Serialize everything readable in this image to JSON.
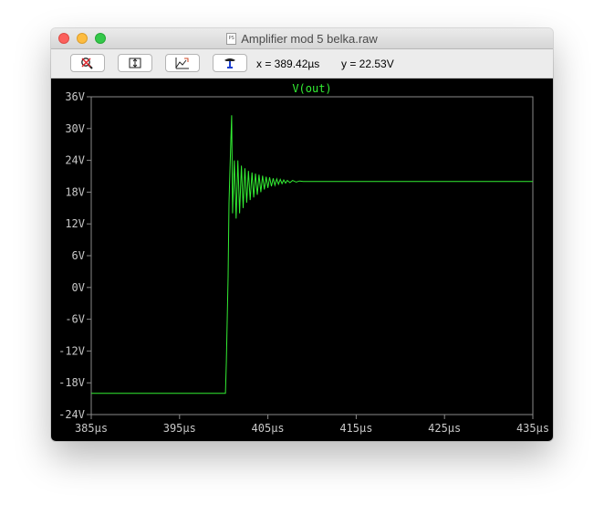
{
  "window": {
    "title": "Amplifier mod 5 belka.raw",
    "file_icon_label": "PS"
  },
  "toolbar": {
    "buttons": [
      {
        "name": "autorange-button",
        "icon": "zoom-reset-icon"
      },
      {
        "name": "zoom-extents-button",
        "icon": "zoom-extents-icon"
      },
      {
        "name": "zoom-back-button",
        "icon": "zoom-back-icon"
      },
      {
        "name": "probe-button",
        "icon": "probe-icon"
      }
    ],
    "cursor_x": "x = 389.42µs",
    "cursor_y": "y = 22.53V"
  },
  "colors": {
    "trace": "#33ee33",
    "axis": "#8a8a8a",
    "label": "#c8c8c8",
    "background": "#000000"
  },
  "chart_data": {
    "type": "line",
    "title": "V(out)",
    "xlabel": "",
    "ylabel": "",
    "xlim": [
      385,
      435
    ],
    "ylim": [
      -24,
      36
    ],
    "grid": false,
    "x_ticks": [
      385,
      395,
      405,
      415,
      425,
      435
    ],
    "x_tick_labels": [
      "385µs",
      "395µs",
      "405µs",
      "415µs",
      "425µs",
      "435µs"
    ],
    "y_ticks": [
      36,
      30,
      24,
      18,
      12,
      6,
      0,
      -6,
      -12,
      -18,
      -24
    ],
    "y_tick_labels": [
      "36V",
      "30V",
      "24V",
      "18V",
      "12V",
      "6V",
      "0V",
      "-6V",
      "-12V",
      "-18V",
      "-24V"
    ],
    "series": [
      {
        "name": "V(out)",
        "x": [
          385,
          400.2,
          400.3,
          400.5,
          400.6,
          400.7,
          400.8,
          400.9,
          401.0,
          401.2,
          401.4,
          401.6,
          401.8,
          402.0,
          402.2,
          402.4,
          402.6,
          402.8,
          403.0,
          403.2,
          403.4,
          403.6,
          403.8,
          404.0,
          404.2,
          404.4,
          404.6,
          404.8,
          405.0,
          405.2,
          405.4,
          405.6,
          405.8,
          406.0,
          406.2,
          406.4,
          406.6,
          406.8,
          407.0,
          407.2,
          407.5,
          407.8,
          408.2,
          408.6,
          409.0,
          435
        ],
        "y": [
          -20,
          -20,
          -14,
          2,
          16,
          22,
          27,
          32.5,
          14,
          24,
          13,
          24,
          14,
          23,
          15,
          22.5,
          16,
          22,
          16.5,
          21.7,
          17,
          21.5,
          17.5,
          21.3,
          18,
          21.1,
          18.5,
          20.9,
          18.8,
          20.8,
          19.1,
          20.6,
          19.3,
          20.5,
          19.5,
          20.4,
          19.6,
          20.3,
          19.7,
          20.2,
          19.8,
          20.2,
          19.9,
          20.1,
          20.0,
          20.0
        ]
      }
    ]
  }
}
